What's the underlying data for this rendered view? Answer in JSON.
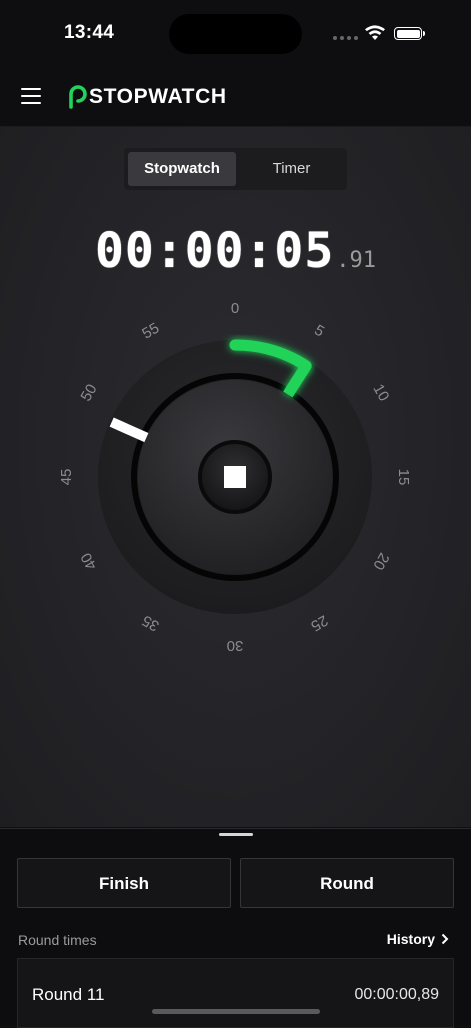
{
  "status_bar": {
    "time": "13:44"
  },
  "header": {
    "logo_text": "STOPWATCH",
    "accent": "#22d35a"
  },
  "mode_tabs": [
    {
      "label": "Stopwatch",
      "active": true
    },
    {
      "label": "Timer",
      "active": false
    }
  ],
  "clock": {
    "main": "00:00:05",
    "fraction": ".91"
  },
  "dial": {
    "tick_labels": [
      "0",
      "5",
      "10",
      "15",
      "20",
      "25",
      "30",
      "35",
      "40",
      "45",
      "50",
      "55"
    ],
    "elapsed_seconds": 5.91,
    "previous_marker_second": 49,
    "progress_color": "#22d35a"
  },
  "controls": {
    "stop_icon": "stop-icon"
  },
  "actions": {
    "finish_label": "Finish",
    "round_label": "Round"
  },
  "rounds": {
    "section_label": "Round times",
    "history_label": "History",
    "items": [
      {
        "name": "Round 11",
        "time": "00:00:00,89"
      }
    ]
  }
}
